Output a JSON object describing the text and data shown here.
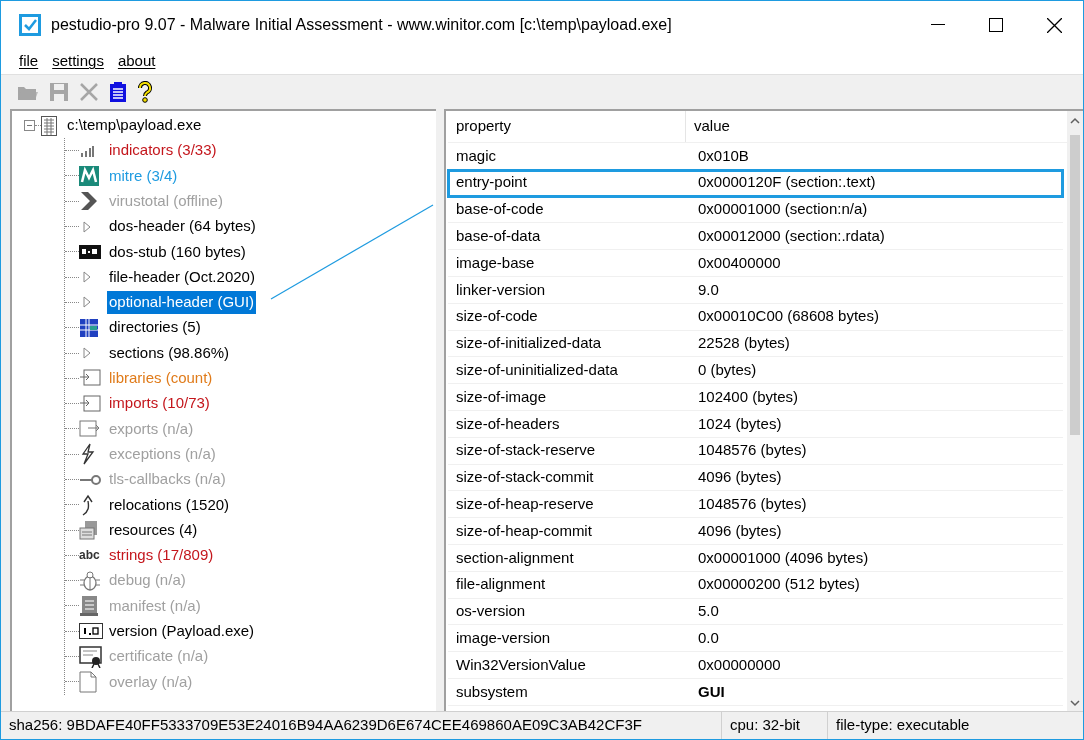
{
  "window": {
    "title": "pestudio-pro 9.07 - Malware Initial Assessment - www.winitor.com [c:\\temp\\payload.exe]"
  },
  "menu": [
    "file",
    "settings",
    "about"
  ],
  "toolbar": [
    {
      "kind": "open",
      "disabled": true
    },
    {
      "kind": "save",
      "disabled": true
    },
    {
      "kind": "close",
      "disabled": true
    },
    {
      "kind": "clipboard",
      "disabled": false
    },
    {
      "kind": "help",
      "disabled": false
    }
  ],
  "tree": {
    "label": "c:\\temp\\payload.exe",
    "expanded": true,
    "children": [
      {
        "label": "indicators (3/33)",
        "kind": "bars",
        "color": "#c4161c",
        "selected": false
      },
      {
        "label": "mitre (3/4)",
        "kind": "mitre",
        "color": "#1e9be0",
        "selected": false
      },
      {
        "label": "virustotal (offline)",
        "kind": "chevron",
        "color": "#a0a0a0",
        "selected": false
      },
      {
        "label": "dos-header (64 bytes)",
        "kind": "arrow",
        "color": "#000000",
        "selected": false
      },
      {
        "label": "dos-stub (160 bytes)",
        "kind": "console",
        "color": "#000000",
        "selected": false
      },
      {
        "label": "file-header (Oct.2020)",
        "kind": "arrow",
        "color": "#000000",
        "selected": false
      },
      {
        "label": "optional-header (GUI)",
        "kind": "arrow",
        "selected": true
      },
      {
        "label": "directories (5)",
        "kind": "grid",
        "color": "#000000",
        "selected": false
      },
      {
        "label": "sections (98.86%)",
        "kind": "arrow",
        "color": "#000000",
        "selected": false
      },
      {
        "label": "libraries (count)",
        "kind": "import",
        "color": "#e07b1a",
        "selected": false
      },
      {
        "label": "imports (10/73)",
        "kind": "import",
        "color": "#c4161c",
        "selected": false
      },
      {
        "label": "exports (n/a)",
        "kind": "export",
        "color": "#a0a0a0",
        "selected": false
      },
      {
        "label": "exceptions (n/a)",
        "kind": "bolt",
        "color": "#a0a0a0",
        "selected": false
      },
      {
        "label": "tls-callbacks (n/a)",
        "kind": "key",
        "color": "#a0a0a0",
        "selected": false
      },
      {
        "label": "relocations (1520)",
        "kind": "up",
        "color": "#000000",
        "selected": false
      },
      {
        "label": "resources (4)",
        "kind": "resources",
        "color": "#000000",
        "selected": false
      },
      {
        "label": "strings (17/809)",
        "kind": "text",
        "icon_text": "abc",
        "color": "#c4161c",
        "selected": false
      },
      {
        "label": "debug (n/a)",
        "kind": "bug",
        "color": "#a0a0a0",
        "selected": false
      },
      {
        "label": "manifest (n/a)",
        "kind": "doc",
        "color": "#a0a0a0",
        "selected": false
      },
      {
        "label": "version (Payload.exe)",
        "kind": "version",
        "color": "#000000",
        "selected": false
      },
      {
        "label": "certificate (n/a)",
        "kind": "cert",
        "color": "#a0a0a0",
        "selected": false
      },
      {
        "label": "overlay (n/a)",
        "kind": "page",
        "color": "#a0a0a0",
        "selected": false
      }
    ]
  },
  "table": {
    "columns": [
      "property",
      "value"
    ],
    "rows": [
      {
        "property": "magic",
        "value": "0x010B",
        "highlighted": false,
        "bold": false
      },
      {
        "property": "entry-point",
        "value": "0x0000120F (section:.text)",
        "highlighted": true,
        "bold": false
      },
      {
        "property": "base-of-code",
        "value": "0x00001000 (section:n/a)",
        "highlighted": false,
        "bold": false
      },
      {
        "property": "base-of-data",
        "value": "0x00012000 (section:.rdata)",
        "highlighted": false,
        "bold": false
      },
      {
        "property": "image-base",
        "value": "0x00400000",
        "highlighted": false,
        "bold": false
      },
      {
        "property": "linker-version",
        "value": "9.0",
        "highlighted": false,
        "bold": false
      },
      {
        "property": "size-of-code",
        "value": "0x00010C00 (68608 bytes)",
        "highlighted": false,
        "bold": false
      },
      {
        "property": "size-of-initialized-data",
        "value": "22528 (bytes)",
        "highlighted": false,
        "bold": false
      },
      {
        "property": "size-of-uninitialized-data",
        "value": "0 (bytes)",
        "highlighted": false,
        "bold": false
      },
      {
        "property": "size-of-image",
        "value": "102400 (bytes)",
        "highlighted": false,
        "bold": false
      },
      {
        "property": "size-of-headers",
        "value": "1024 (bytes)",
        "highlighted": false,
        "bold": false
      },
      {
        "property": "size-of-stack-reserve",
        "value": "1048576 (bytes)",
        "highlighted": false,
        "bold": false
      },
      {
        "property": "size-of-stack-commit",
        "value": "4096 (bytes)",
        "highlighted": false,
        "bold": false
      },
      {
        "property": "size-of-heap-reserve",
        "value": "1048576 (bytes)",
        "highlighted": false,
        "bold": false
      },
      {
        "property": "size-of-heap-commit",
        "value": "4096 (bytes)",
        "highlighted": false,
        "bold": false
      },
      {
        "property": "section-alignment",
        "value": "0x00001000 (4096 bytes)",
        "highlighted": false,
        "bold": false
      },
      {
        "property": "file-alignment",
        "value": "0x00000200 (512 bytes)",
        "highlighted": false,
        "bold": false
      },
      {
        "property": "os-version",
        "value": "5.0",
        "highlighted": false,
        "bold": false
      },
      {
        "property": "image-version",
        "value": "0.0",
        "highlighted": false,
        "bold": false
      },
      {
        "property": "Win32VersionValue",
        "value": "0x00000000",
        "highlighted": false,
        "bold": false
      },
      {
        "property": "subsystem",
        "value": "GUI",
        "highlighted": false,
        "bold": true
      }
    ]
  },
  "status_bar": [
    "sha256: 9BDAFE40FF5333709E53E24016B94AA6239D6E674CEE469860AE09C3AB42CF3F",
    "cpu: 32-bit",
    "file-type: executable"
  ]
}
